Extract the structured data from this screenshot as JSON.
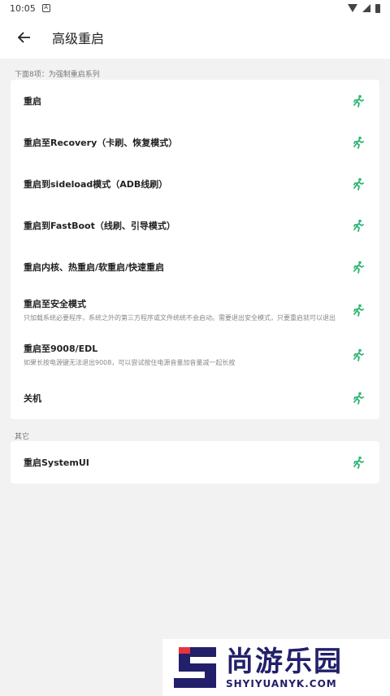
{
  "status": {
    "time": "10:05"
  },
  "header": {
    "title": "高级重启"
  },
  "sections": {
    "force": {
      "label": "下面8项：为强制重启系列",
      "items": [
        {
          "title": "重启",
          "desc": ""
        },
        {
          "title": "重启至Recovery（卡刷、恢复模式）",
          "desc": ""
        },
        {
          "title": "重启到sideload模式（ADB线刷）",
          "desc": ""
        },
        {
          "title": "重启到FastBoot（线刷、引导模式）",
          "desc": ""
        },
        {
          "title": "重启内核、热重启/软重启/快速重启",
          "desc": ""
        },
        {
          "title": "重启至安全模式",
          "desc": "只加载系统必要程序，系统之外的第三方程序或文件统统不会启动。需要退出安全模式，只要重启就可以退出"
        },
        {
          "title": "重启至9008/EDL",
          "desc": "如果长按电源键无法退出9008，可以尝试按住电源音量加音量减一起长按"
        },
        {
          "title": "关机",
          "desc": ""
        }
      ]
    },
    "other": {
      "label": "其它",
      "items": [
        {
          "title": "重启SystemUI",
          "desc": ""
        }
      ]
    }
  },
  "icons": {
    "run": "run-icon",
    "back": "arrow-left-icon"
  },
  "colors": {
    "accent": "#2bb673",
    "brand": "#22206a",
    "brand_red": "#e8343c"
  },
  "watermark": {
    "cn": "尚游乐园",
    "en": "SHYIYUANYK.COM"
  }
}
